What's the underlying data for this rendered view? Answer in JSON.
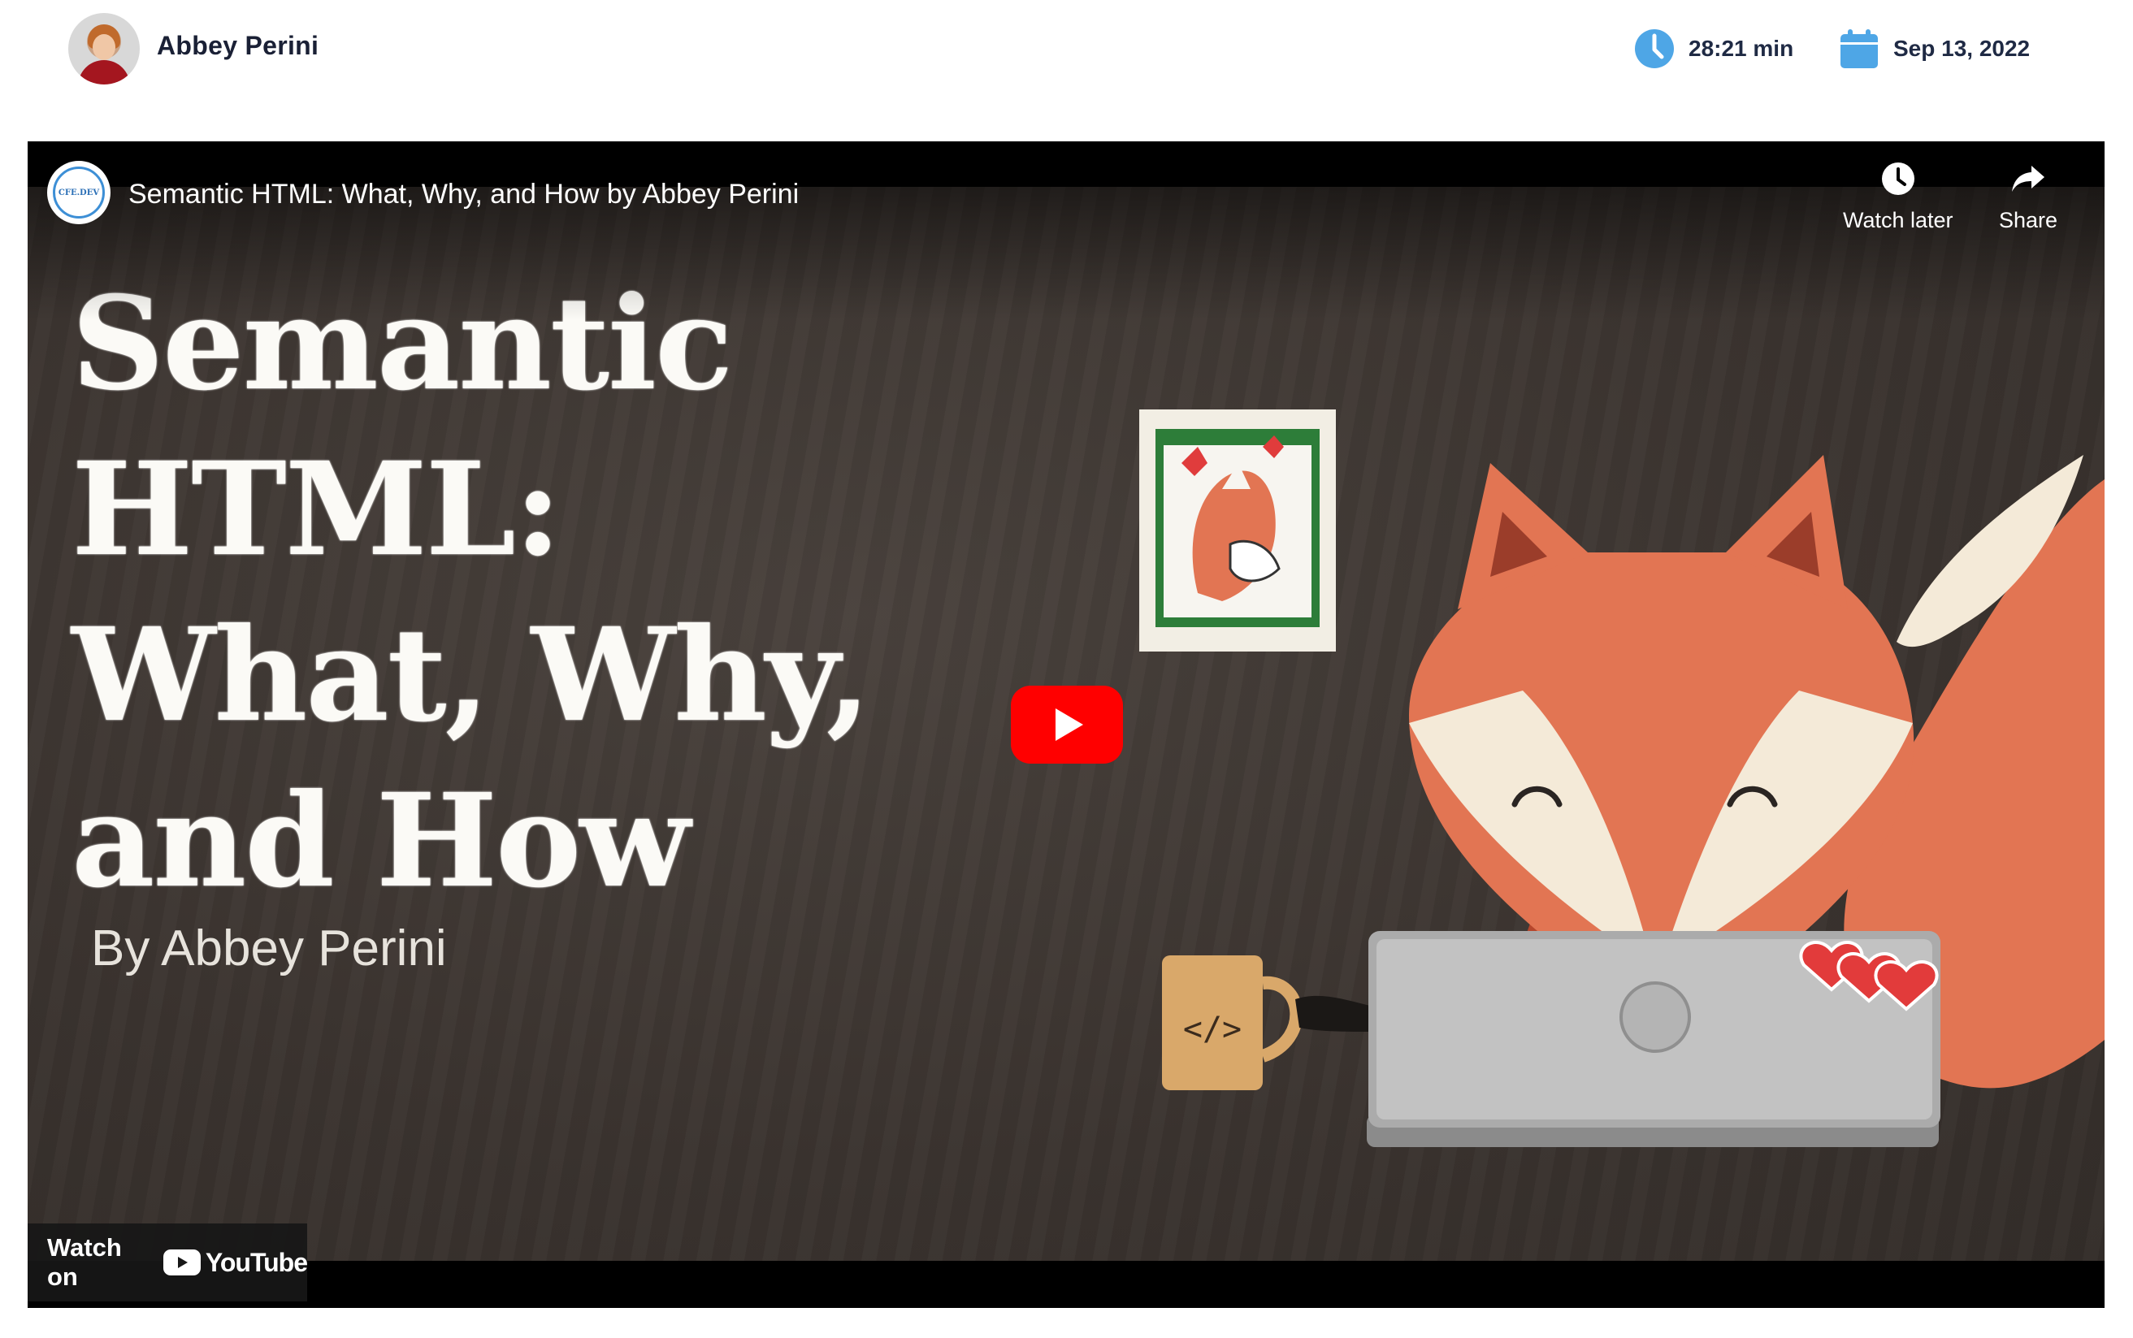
{
  "author": {
    "name": "Abbey Perini"
  },
  "meta": {
    "duration": "28:21 min",
    "date": "Sep 13, 2022"
  },
  "video": {
    "title": "Semantic HTML: What, Why, and How by Abbey Perini",
    "channel_logo_text": "CFE.DEV",
    "actions": {
      "watch_later": "Watch later",
      "share": "Share"
    },
    "thumbnail": {
      "title_lines": [
        "Semantic",
        "HTML:",
        "What, Why,",
        "and How"
      ],
      "byline": "By Abbey Perini",
      "mug_text": "</>"
    },
    "watch_on": {
      "label": "Watch on",
      "brand": "YouTube"
    }
  },
  "colors": {
    "accent_blue": "#4ea6e6",
    "youtube_red": "#ff0000",
    "fox_orange": "#e27553",
    "board_brown": "#3d3631"
  },
  "icons": {
    "duration": "clock-icon",
    "date": "calendar-icon",
    "watch_later": "clock-icon",
    "share": "share-arrow-icon",
    "play": "play-icon"
  }
}
